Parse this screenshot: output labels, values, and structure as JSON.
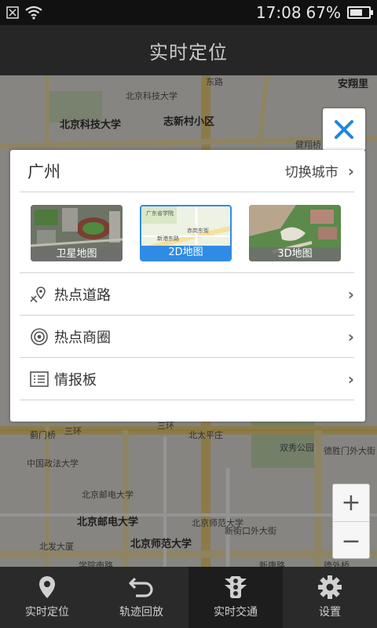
{
  "status_bar": {
    "time": "17:08",
    "battery": "67%",
    "battery_fraction": 0.67
  },
  "header": {
    "title": "实时定位"
  },
  "map": {
    "labels": [
      {
        "text": "北京科技大学",
        "bold": false
      },
      {
        "text": "北京科技大学",
        "bold": true
      },
      {
        "text": "志新村小区",
        "bold": true
      },
      {
        "text": "健翔桥",
        "bold": false
      },
      {
        "text": "东路",
        "bold": false
      },
      {
        "text": "安翔里",
        "bold": true
      },
      {
        "text": "蓟门桥",
        "bold": false
      },
      {
        "text": "三环",
        "bold": false
      },
      {
        "text": "三环",
        "bold": false
      },
      {
        "text": "北太平庄",
        "bold": false
      },
      {
        "text": "双秀公园",
        "bold": false
      },
      {
        "text": "中国政法大学",
        "bold": false
      },
      {
        "text": "北京邮电大学",
        "bold": false
      },
      {
        "text": "北京邮电大学",
        "bold": true
      },
      {
        "text": "北京师范大学",
        "bold": false
      },
      {
        "text": "北京师范大学",
        "bold": true
      },
      {
        "text": "北发大厦",
        "bold": false
      },
      {
        "text": "新康路",
        "bold": false
      },
      {
        "text": "德外桥",
        "bold": false
      },
      {
        "text": "德胜门外大街",
        "bold": false
      },
      {
        "text": "新街口外大街",
        "bold": false
      },
      {
        "text": "学院南路",
        "bold": false
      }
    ]
  },
  "zoom": {
    "in_label": "+",
    "out_label": "−"
  },
  "panel": {
    "city": "广州",
    "switch_city_label": "切换城市",
    "chevron": "›",
    "map_types": [
      {
        "label": "卫星地图",
        "selected": false,
        "thumb_labels": []
      },
      {
        "label": "2D地图",
        "selected": true,
        "thumb_labels": [
          "广东省学院",
          "新港东路",
          "赤岗东街"
        ]
      },
      {
        "label": "3D地图",
        "selected": false,
        "thumb_labels": []
      }
    ],
    "items": [
      {
        "label": "热点道路",
        "icon": "road-pin-icon"
      },
      {
        "label": "热点商圈",
        "icon": "radar-icon"
      },
      {
        "label": "情报板",
        "icon": "list-board-icon"
      }
    ]
  },
  "tabs": [
    {
      "label": "实时定位",
      "icon": "location-pin-icon",
      "active": false
    },
    {
      "label": "轨迹回放",
      "icon": "replay-arrow-icon",
      "active": false
    },
    {
      "label": "实时交通",
      "icon": "traffic-light-icon",
      "active": true
    },
    {
      "label": "设置",
      "icon": "gear-icon",
      "active": false
    }
  ],
  "colors": {
    "accent": "#2f8be6",
    "close_x": "#1f86e0",
    "title_bg": "#262626",
    "tab_bg": "#2a2a2a"
  }
}
